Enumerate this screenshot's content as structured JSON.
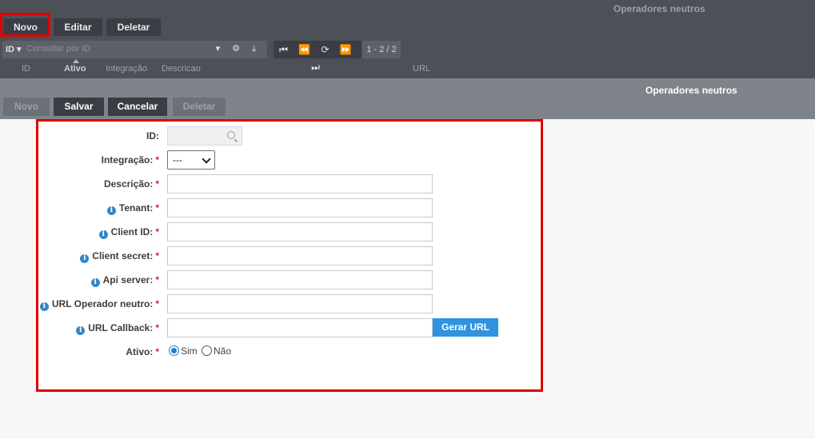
{
  "background_panel": {
    "title": "Operadores neutros",
    "toolbar": {
      "novo": "Novo",
      "editar": "Editar",
      "deletar": "Deletar"
    },
    "search": {
      "field": "ID",
      "placeholder": "Consultar por ID"
    },
    "pager": "1 - 2 / 2",
    "columns": [
      "ID",
      "Ativo",
      "Integração",
      "Descricao",
      "URL"
    ]
  },
  "form_panel": {
    "title": "Operadores neutros",
    "toolbar": {
      "novo": "Novo",
      "salvar": "Salvar",
      "cancelar": "Cancelar",
      "deletar": "Deletar"
    },
    "fields": {
      "id": "ID:",
      "integracao": "Integração:",
      "descricao": "Descrição:",
      "tenant": "Tenant:",
      "client_id": "Client ID:",
      "client_secret": "Client secret:",
      "api_server": "Api server:",
      "url_operador": "URL Operador neutro:",
      "url_callback": "URL Callback:",
      "ativo": "Ativo:"
    },
    "required_mark": "*",
    "info_glyph": "i",
    "integracao_value": "---",
    "gerar_url": "Gerar URL",
    "radio": {
      "sim": "Sim",
      "nao": "Não",
      "selected": "Sim"
    }
  },
  "colors": {
    "highlight": "#e00000",
    "accent": "#2f93e0",
    "header_dark": "#4d5157",
    "header_light": "#7e848a"
  }
}
